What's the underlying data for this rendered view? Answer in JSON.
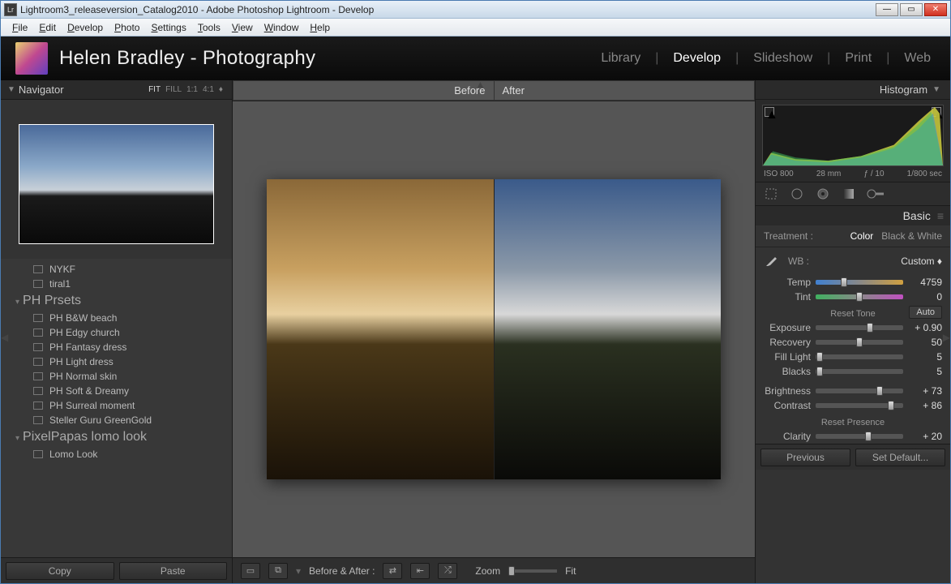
{
  "window": {
    "title": "Lightroom3_releaseversion_Catalog2010 - Adobe Photoshop Lightroom - Develop",
    "app_icon": "Lr"
  },
  "menubar": [
    "File",
    "Edit",
    "Develop",
    "Photo",
    "Settings",
    "Tools",
    "View",
    "Window",
    "Help"
  ],
  "brand": "Helen Bradley - Photography",
  "modules": {
    "items": [
      "Library",
      "Develop",
      "Slideshow",
      "Print",
      "Web"
    ],
    "active": "Develop"
  },
  "navigator": {
    "title": "Navigator",
    "zoom_options": [
      "FIT",
      "FILL",
      "1:1",
      "4:1"
    ],
    "zoom_active": "FIT"
  },
  "presets": {
    "loose_items": [
      "NYKF",
      "tiral1"
    ],
    "groups": [
      {
        "name": "PH Prsets",
        "items": [
          "PH B&W beach",
          "PH Edgy church",
          "PH Fantasy dress",
          "PH Light dress",
          "PH Normal skin",
          "PH Soft & Dreamy",
          "PH Surreal moment",
          "Steller Guru GreenGold"
        ]
      },
      {
        "name": "PixelPapas lomo look",
        "items": [
          "Lomo Look"
        ]
      }
    ]
  },
  "left_buttons": {
    "copy": "Copy",
    "paste": "Paste"
  },
  "compare": {
    "before": "Before",
    "after": "After",
    "toolbar_label": "Before & After :",
    "zoom_label": "Zoom",
    "fit_label": "Fit"
  },
  "histogram": {
    "title": "Histogram",
    "meta": {
      "iso": "ISO 800",
      "focal": "28 mm",
      "aperture": "ƒ / 10",
      "shutter": "1/800 sec"
    }
  },
  "tools": [
    "crop-tool",
    "spot-tool",
    "redeye-tool",
    "grad-filter-tool",
    "brush-tool"
  ],
  "basic": {
    "title": "Basic",
    "treatment_label": "Treatment :",
    "treatments": [
      "Color",
      "Black & White"
    ],
    "treatment_active": "Color",
    "wb_label": "WB :",
    "wb_value": "Custom",
    "temp_label": "Temp",
    "temp_value": "4759",
    "tint_label": "Tint",
    "tint_value": "0",
    "reset_tone": "Reset Tone",
    "auto": "Auto",
    "sliders_tone": [
      {
        "label": "Exposure",
        "value": "+ 0.90",
        "pos": 62
      },
      {
        "label": "Recovery",
        "value": "50",
        "pos": 50
      },
      {
        "label": "Fill Light",
        "value": "5",
        "pos": 5
      },
      {
        "label": "Blacks",
        "value": "5",
        "pos": 5
      }
    ],
    "sliders_tone2": [
      {
        "label": "Brightness",
        "value": "+ 73",
        "pos": 73
      },
      {
        "label": "Contrast",
        "value": "+ 86",
        "pos": 86
      }
    ],
    "reset_presence": "Reset Presence",
    "sliders_presence": [
      {
        "label": "Clarity",
        "value": "+ 20",
        "pos": 60
      }
    ]
  },
  "right_buttons": {
    "previous": "Previous",
    "setdefault": "Set Default..."
  }
}
